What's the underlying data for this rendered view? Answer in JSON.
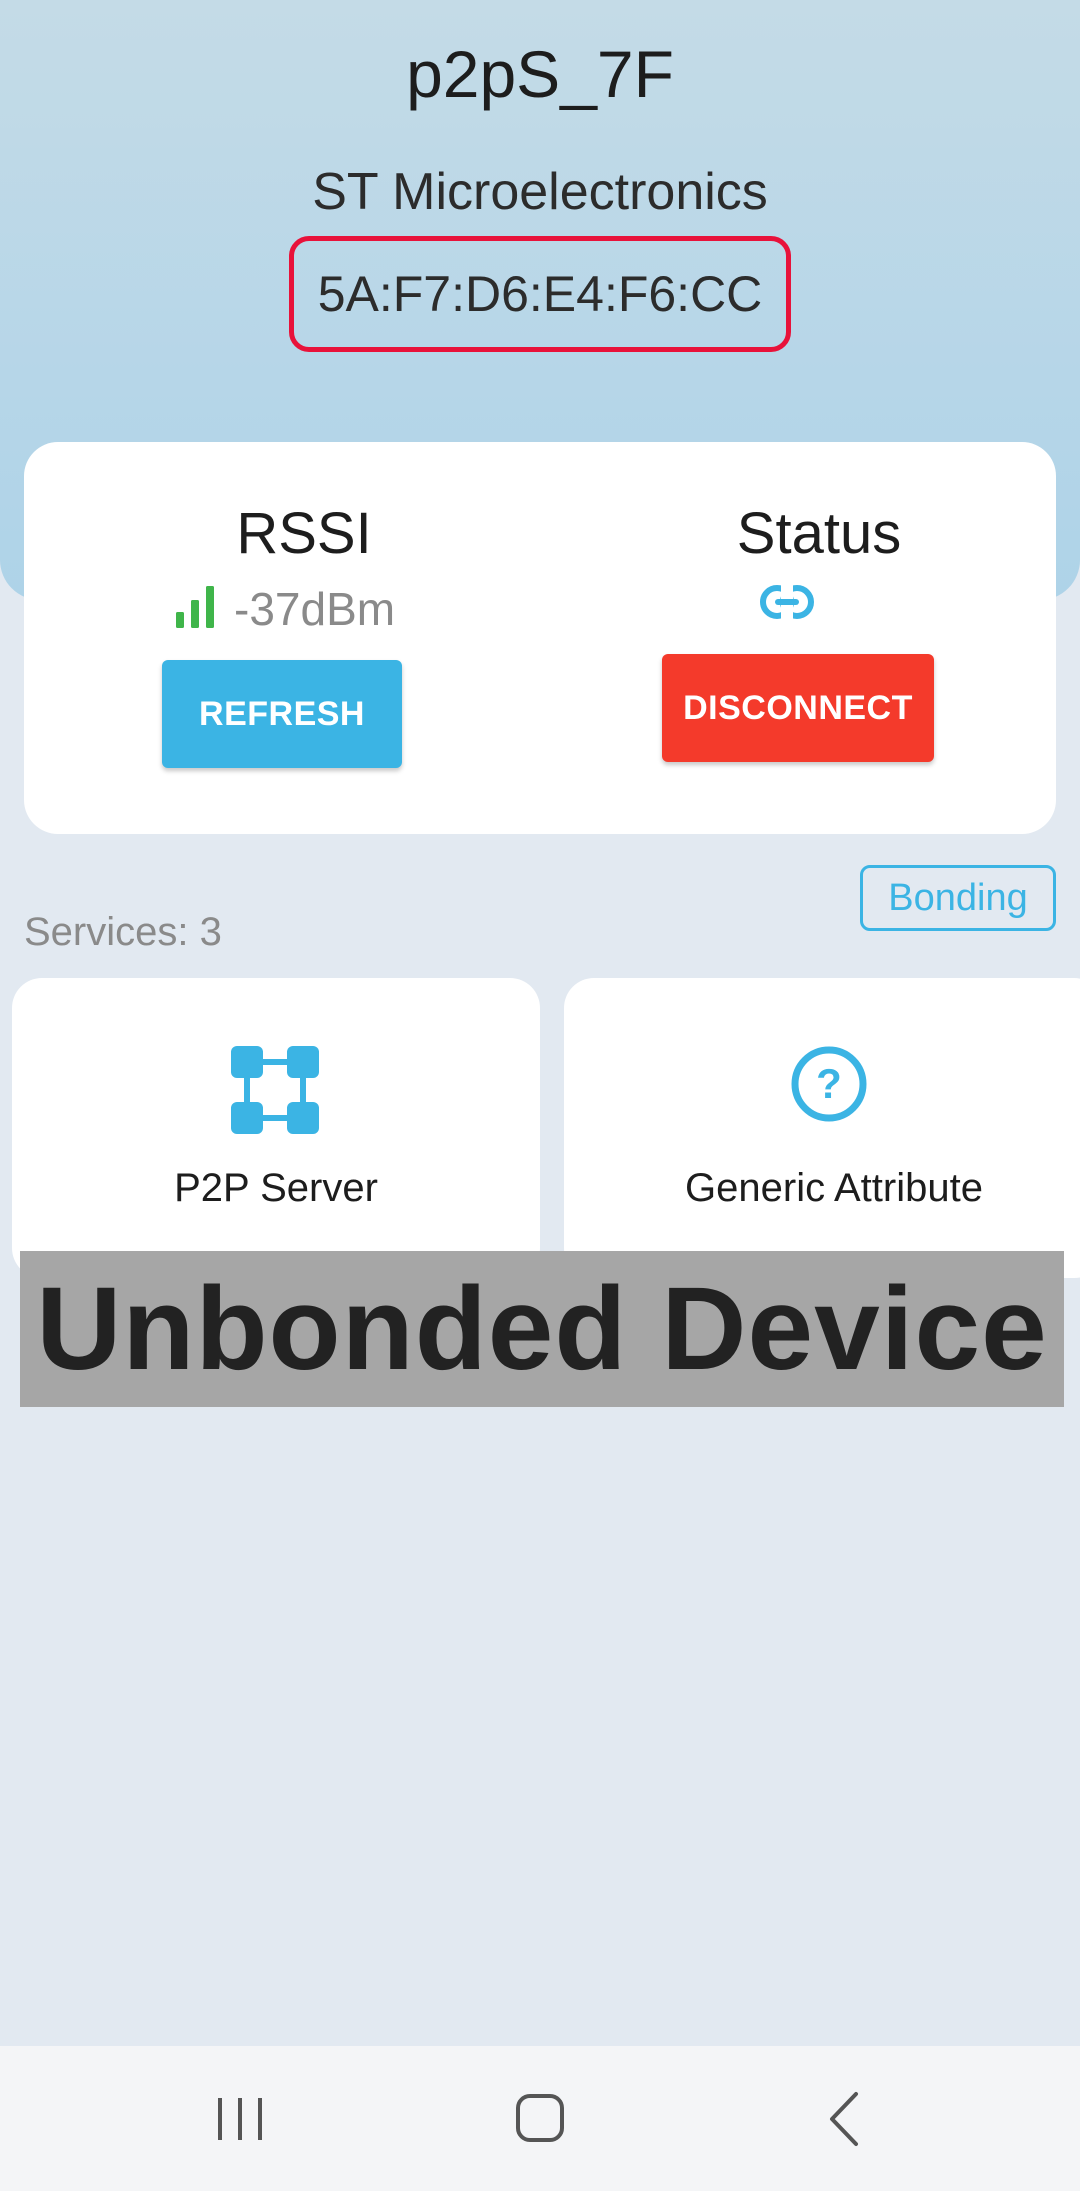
{
  "header": {
    "device_name": "p2pS_7F",
    "manufacturer": "ST Microelectronics",
    "mac_address": "5A:F7:D6:E4:F6:CC",
    "highlight_color": "#e8123a"
  },
  "info_card": {
    "rssi_title": "RSSI",
    "rssi_value": "-37dBm",
    "signal_icon": "signal-bars-icon",
    "refresh_label": "REFRESH",
    "status_title": "Status",
    "status_icon": "link-icon",
    "disconnect_label": "DISCONNECT"
  },
  "services": {
    "bonding_label": "Bonding",
    "count_label": "Services: 3",
    "items": [
      {
        "label": "P2P Server",
        "icon": "p2p-network-icon"
      },
      {
        "label": "Generic Attribute",
        "icon": "question-circle-icon"
      }
    ]
  },
  "overlay": {
    "text": "Unbonded Device"
  },
  "nav_bar": {
    "recents_icon": "recents-icon",
    "home_icon": "home-icon",
    "back_icon": "back-icon"
  },
  "colors": {
    "accent": "#3bb4e4",
    "danger": "#f43a2b",
    "signal": "#3fb54a"
  }
}
